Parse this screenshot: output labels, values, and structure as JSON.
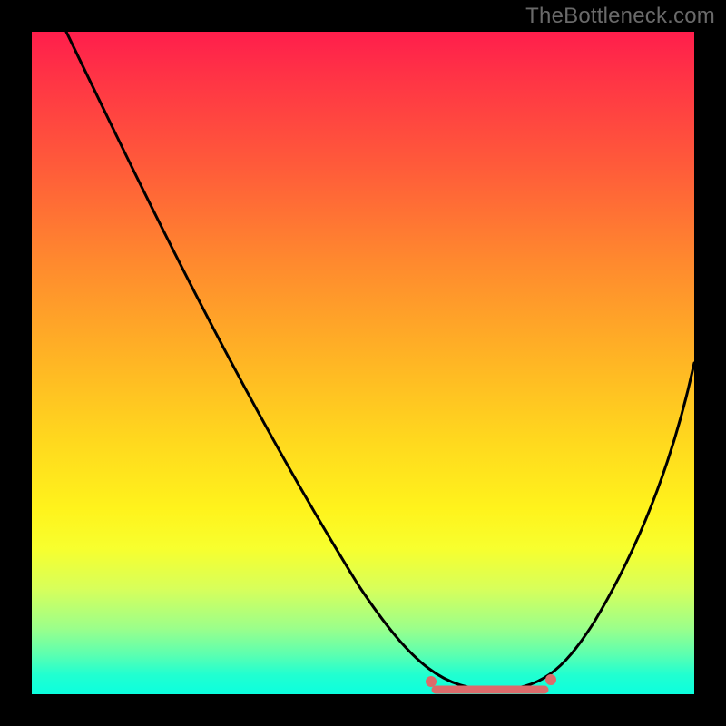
{
  "watermark": "TheBottleneck.com",
  "chart_data": {
    "type": "line",
    "title": "",
    "xlabel": "",
    "ylabel": "",
    "xlim": [
      0,
      100
    ],
    "ylim": [
      0,
      100
    ],
    "x": [
      5,
      10,
      15,
      20,
      25,
      30,
      35,
      40,
      45,
      50,
      55,
      58,
      61,
      64,
      67,
      70,
      73,
      76,
      79,
      82,
      85,
      88,
      91,
      94,
      97,
      100
    ],
    "values": [
      100,
      91,
      82,
      73,
      64,
      55,
      46,
      37,
      28,
      20,
      12,
      8,
      5,
      3,
      1.5,
      0.8,
      0.4,
      0.4,
      0.8,
      2,
      5,
      10,
      17,
      26,
      37,
      50
    ],
    "highlight_range_x": [
      61,
      82
    ],
    "gradient_colors": {
      "top": "#ff1e4c",
      "mid": "#fff31c",
      "bottom": "#0bffde"
    },
    "highlight_color": "#dc6b6b",
    "curve_color": "#000000"
  }
}
